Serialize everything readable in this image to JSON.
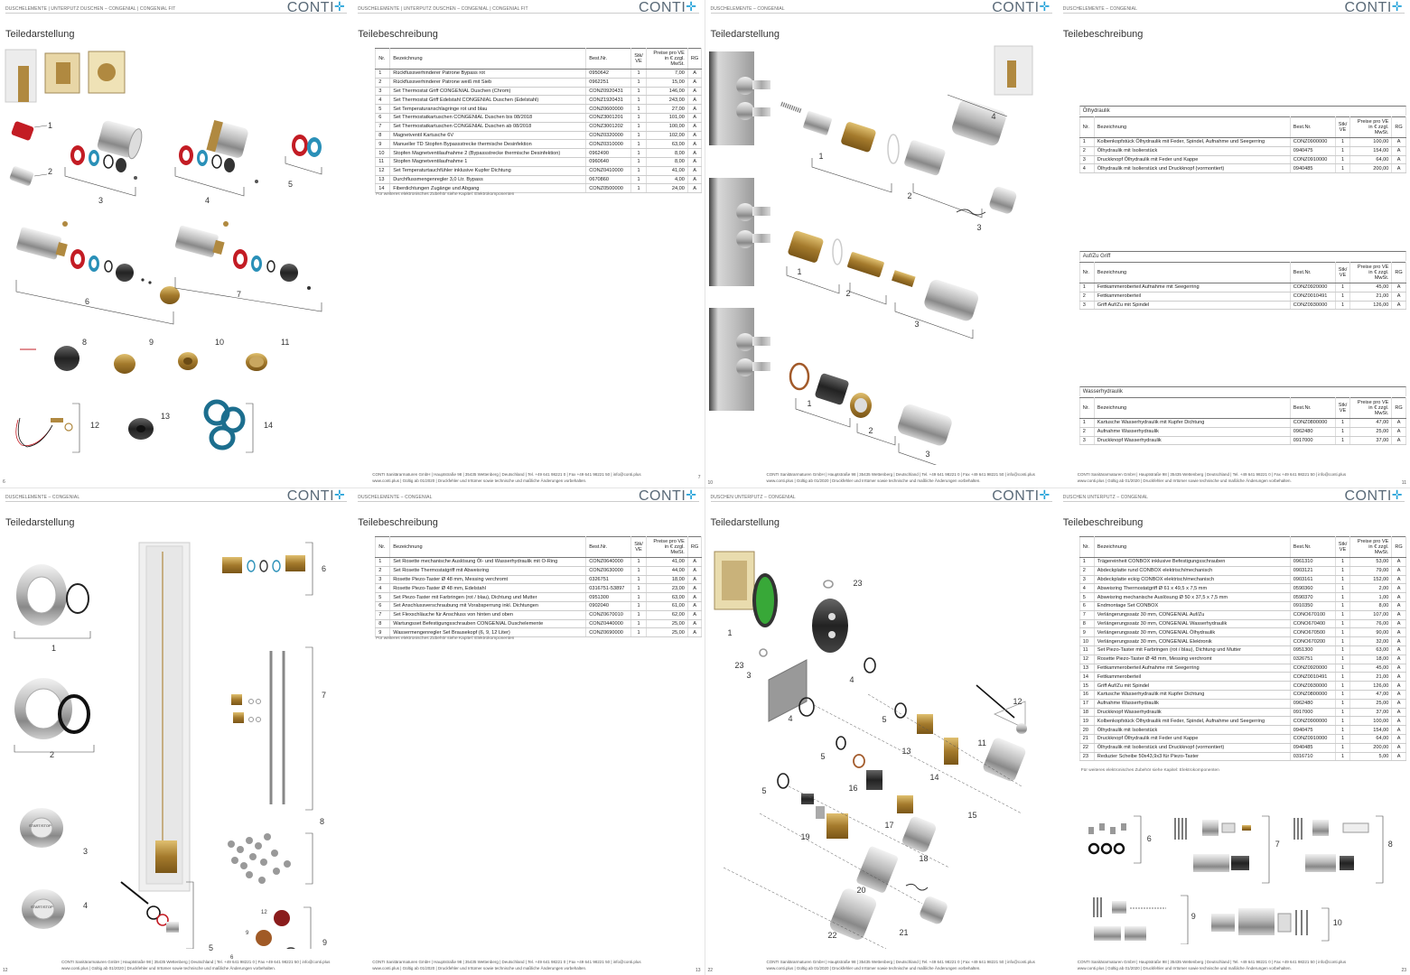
{
  "brand": {
    "logo_text": "CONTI",
    "accent": "#1fa0d8"
  },
  "footer": {
    "line1": "CONTI Sanitärarmaturen GmbH | Hauptstraße 98 | 35435 Wettenberg | Deutschland | Tel. +49 641 98221 0 | Fax +49 641 98221 50 | info@conti.plus",
    "line2": "www.conti.plus | Gültig ab 01/2020 | Druckfehler und Irrtümer sowie technische und maßliche Änderungen vorbehalten."
  },
  "table_headers": {
    "nr": "Nr.",
    "bez": "Bezeichnung",
    "best": "Best.Nr.",
    "stk": "Stk/ VE",
    "preis": "Preise pro VE in € zzgl. MwSt.",
    "preis2": "Preise pro VE in € zzgl. MwSt.",
    "rg": "RG"
  },
  "pages": [
    {
      "header": "DUSCHELEMENTE | UNTERPUTZ DUSCHEN – CONGENIAL | CONGENIAL FIT",
      "title": "Teiledarstellung",
      "num": "6",
      "labels": [
        "1",
        "2",
        "3",
        "4",
        "5",
        "6",
        "7",
        "8",
        "9",
        "10",
        "11",
        "12",
        "13",
        "14"
      ]
    },
    {
      "header": "DUSCHELEMENTE | UNTERPUTZ DUSCHEN – CONGENIAL | CONGENIAL FIT",
      "title": "Teilebeschreibung",
      "num": "7",
      "rows": [
        [
          "1",
          "Rückflussverhinderer Patrone Bypass rot",
          "0950642",
          "1",
          "7,00",
          "A"
        ],
        [
          "2",
          "Rückflussverhinderer Patrone weiß mit Sieb",
          "0962251",
          "1",
          "15,00",
          "A"
        ],
        [
          "3",
          "Set Thermostat Griff CONGENIAL Duschen (Chrom)",
          "CONZ0920431",
          "1",
          "146,00",
          "A"
        ],
        [
          "4",
          "Set Thermostat Griff Edelstahl CONGENIAL Duschen (Edelstahl)",
          "CONZ1920431",
          "1",
          "243,00",
          "A"
        ],
        [
          "5",
          "Set Temperaturanschlagringe rot und blau",
          "CONZ0600000",
          "1",
          "27,00",
          "A"
        ],
        [
          "6",
          "Set Thermostatkartuschen CONGENIAL Duschen bis 08/2018",
          "CONZ3001201",
          "1",
          "101,00",
          "A"
        ],
        [
          "7",
          "Set Thermostatkartuschen CONGENIAL Duschen ab 08/2018",
          "CONZ3001202",
          "1",
          "100,00",
          "A"
        ],
        [
          "8",
          "Magnetventil Kartusche 6V",
          "CONZ0320000",
          "1",
          "102,00",
          "A"
        ],
        [
          "9",
          "Manueller TD Stopfen Bypassstrecke thermische Desinfektion",
          "CONZ0310000",
          "1",
          "63,00",
          "A"
        ],
        [
          "10",
          "Stopfen Magnetventilaufnahme 2 (Bypassstrecke thermische Desinfektion)",
          "0962490",
          "1",
          "8,00",
          "A"
        ],
        [
          "11",
          "Stopfen Magnetventilaufnahme 1",
          "0960640",
          "1",
          "8,00",
          "A"
        ],
        [
          "12",
          "Set Temperaturtauchfühler inklusive Kupfer Dichtung",
          "CONZ0410000",
          "1",
          "41,00",
          "A"
        ],
        [
          "13",
          "Durchflussmengenregler 3,0 Ltr. Bypass",
          "0670860",
          "1",
          "4,00",
          "A"
        ],
        [
          "14",
          "Fiberdichtungen Zugänge und Abgang",
          "CONZ0500000",
          "1",
          "24,00",
          "A"
        ]
      ],
      "note": "Für weiteres elektronisches Zubehör siehe Kapitel: Elektrokomponenten"
    },
    {
      "header": "DUSCHELEMENTE – CONGENIAL",
      "title": "Teiledarstellung",
      "num": "10",
      "labels": [
        "4",
        "1",
        "2",
        "3",
        "1",
        "2",
        "3",
        "1",
        "2",
        "3"
      ]
    },
    {
      "header": "DUSCHELEMENTE – CONGENIAL",
      "title": "Teilebeschreibung",
      "num": "11",
      "sections": [
        {
          "name": "Ölhydraulik",
          "rows": [
            [
              "1",
              "Kolbenkopfstück Ölhydraulik mit Feder, Spindel, Aufnahme und Seegerring",
              "CONZ0900000",
              "1",
              "100,00",
              "A"
            ],
            [
              "2",
              "Ölhydraulik mit Isolierstück",
              "0940475",
              "1",
              "154,00",
              "A"
            ],
            [
              "3",
              "Druckknopf Ölhydraulik mit Feder und Kappe",
              "CONZ0910000",
              "1",
              "64,00",
              "A"
            ],
            [
              "4",
              "Ölhydraulik mit Isolierstück und Druckknopf (vormontiert)",
              "0940485",
              "1",
              "200,00",
              "A"
            ]
          ]
        },
        {
          "name": "Auf/Zu Griff",
          "rows": [
            [
              "1",
              "Fettkammeroberteil Aufnahme mit Seegerring",
              "CONZ0920000",
              "1",
              "45,00",
              "A"
            ],
            [
              "2",
              "Fettkammeroberteil",
              "CONZ0010491",
              "1",
              "21,00",
              "A"
            ],
            [
              "3",
              "Griff Auf/Zu mit Spindel",
              "CONZ0930000",
              "1",
              "126,00",
              "A"
            ]
          ]
        },
        {
          "name": "Wasserhydraulik",
          "rows": [
            [
              "1",
              "Kartusche Wasserhydraulik mit Kupfer Dichtung",
              "CONZ0800000",
              "1",
              "47,00",
              "A"
            ],
            [
              "2",
              "Aufnahme Wasserhydraulik",
              "0962480",
              "1",
              "25,00",
              "A"
            ],
            [
              "3",
              "Druckknopf Wasserhydraulik",
              "0917000",
              "1",
              "37,00",
              "A"
            ]
          ]
        }
      ]
    },
    {
      "header": "DUSCHELEMENTE – CONGENIAL",
      "title": "Teiledarstellung",
      "num": "12",
      "labels": [
        "1",
        "2",
        "3",
        "4",
        "5",
        "6",
        "7",
        "8",
        "9",
        "12",
        "9",
        "6"
      ],
      "startstop": "START/STOP"
    },
    {
      "header": "DUSCHELEMENTE – CONGENIAL",
      "title": "Teilebeschreibung",
      "num": "13",
      "rows": [
        [
          "1",
          "Set Rosette mechanische Auslösung Öl- und Wasserhydraulik mit O-Ring",
          "CONZ0640000",
          "1",
          "41,00",
          "A"
        ],
        [
          "2",
          "Set Rosette Thermostatgriff mit Abweisring",
          "CONZ0630000",
          "1",
          "44,00",
          "A"
        ],
        [
          "3",
          "Rosette Piezo-Taster Ø 48 mm, Messing verchromt",
          "0326751",
          "1",
          "18,00",
          "A"
        ],
        [
          "4",
          "Rosette Piezo-Taster Ø 48 mm, Edelstahl",
          "0316751-53897",
          "1",
          "23,00",
          "A"
        ],
        [
          "5",
          "Set Piezo-Taster mit Farbringen (rot / blau), Dichtung und Mutter",
          "0951300",
          "1",
          "63,00",
          "A"
        ],
        [
          "6",
          "Set Anschlussverschraubung mit Vorabsperrung inkl. Dichtungen",
          "0902040",
          "1",
          "61,00",
          "A"
        ],
        [
          "7",
          "Set Flexschläuche für Anschluss von hinten und oben",
          "CONZ0670010",
          "1",
          "62,00",
          "A"
        ],
        [
          "8",
          "Wartungsset Befestigungsschrauben CONGENIAL Duschelemente",
          "CONZ0440000",
          "1",
          "25,00",
          "A"
        ],
        [
          "9",
          "Wassermengenregler Set Brausekopf (6, 9, 12 Liter)",
          "CONZ0690000",
          "1",
          "25,00",
          "A"
        ]
      ],
      "note": "Für weiteres elektronisches Zubehör siehe Kapitel: Elektrokomponenten"
    },
    {
      "header": "DUSCHEN UNTERPUTZ – CONGENIAL",
      "title": "Teiledarstellung",
      "num": "22",
      "labels": [
        "23",
        "1",
        "2",
        "23",
        "3",
        "4",
        "4",
        "5",
        "5",
        "5",
        "12",
        "11",
        "13",
        "14",
        "16",
        "15",
        "17",
        "18",
        "19",
        "20",
        "21",
        "22"
      ]
    },
    {
      "header": "DUSCHEN UNTERPUTZ – CONGENIAL",
      "title": "Teilebeschreibung",
      "num": "23",
      "rows": [
        [
          "1",
          "Trägereinheit CONBOX inklusive Befestigungsschrauben",
          "0961310",
          "1",
          "53,00",
          "A"
        ],
        [
          "2",
          "Abdeckplatte rund CONBOX elektrisch/mechanisch",
          "0903121",
          "1",
          "79,00",
          "A"
        ],
        [
          "3",
          "Abdeckplatte eckig CONBOX elektrisch/mechanisch",
          "0903161",
          "1",
          "152,00",
          "A"
        ],
        [
          "4",
          "Abweisring Thermostatgriff Ø 61 x 49,5 x 7,5 mm",
          "0590360",
          "1",
          "2,00",
          "A"
        ],
        [
          "5",
          "Abweisring mechanische Auslösung Ø 50 x 37,5 x 7,5 mm",
          "0590370",
          "1",
          "1,00",
          "A"
        ],
        [
          "6",
          "Endmontage Set CONBOX",
          "0910350",
          "1",
          "8,00",
          "A"
        ],
        [
          "7",
          "Verlängerungssatz 30 mm, CONGENIAL Auf/Zu",
          "CONO670100",
          "1",
          "107,00",
          "A"
        ],
        [
          "8",
          "Verlängerungssatz 30 mm, CONGENIAL Wasserhydraulik",
          "CONO670400",
          "1",
          "76,00",
          "A"
        ],
        [
          "9",
          "Verlängerungssatz 30 mm, CONGENIAL Ölhydraulik",
          "CONO670500",
          "1",
          "90,00",
          "A"
        ],
        [
          "10",
          "Verlängerungssatz 30 mm, CONGENIAL Elektronik",
          "CONO670200",
          "1",
          "32,00",
          "A"
        ],
        [
          "11",
          "Set Piezo-Taster mit Farbringen (rot / blau), Dichtung und Mutter",
          "0951300",
          "1",
          "63,00",
          "A"
        ],
        [
          "12",
          "Rosette Piezo-Taster Ø 48 mm, Messing verchromt",
          "0326751",
          "1",
          "18,00",
          "A"
        ],
        [
          "13",
          "Fettkammeroberteil Aufnahme mit Seegerring",
          "CONZ0920000",
          "1",
          "45,00",
          "A"
        ],
        [
          "14",
          "Fettkammeroberteil",
          "CONZ0010491",
          "1",
          "21,00",
          "A"
        ],
        [
          "15",
          "Griff Auf/Zu mit Spindel",
          "CONZ0930000",
          "1",
          "126,00",
          "A"
        ],
        [
          "16",
          "Kartusche Wasserhydraulik mit Kupfer Dichtung",
          "CONZ0800000",
          "1",
          "47,00",
          "A"
        ],
        [
          "17",
          "Aufnahme Wasserhydraulik",
          "0962480",
          "1",
          "25,00",
          "A"
        ],
        [
          "18",
          "Druckknopf Wasserhydraulik",
          "0917000",
          "1",
          "37,00",
          "A"
        ],
        [
          "19",
          "Kolbenkopfstück Ölhydraulik mit Feder, Spindel, Aufnahme und Seegerring",
          "CONZ0900000",
          "1",
          "100,00",
          "A"
        ],
        [
          "20",
          "Ölhydraulik mit Isolierstück",
          "0940475",
          "1",
          "154,00",
          "A"
        ],
        [
          "21",
          "Druckknopf Ölhydraulik mit Feder und Kappe",
          "CONZ0910000",
          "1",
          "64,00",
          "A"
        ],
        [
          "22",
          "Ölhydraulik mit Isolierstück und Druckknopf (vormontiert)",
          "0940485",
          "1",
          "200,00",
          "A"
        ],
        [
          "23",
          "Reduzier Scheibe 50x43,9x3 für Piezo-Taster",
          "0316710",
          "1",
          "5,00",
          "A"
        ]
      ],
      "note": "Für weiteres elektronisches Zubehör siehe Kapitel: Elektrokomponenten",
      "labels": [
        "6",
        "7",
        "8",
        "9",
        "10"
      ]
    }
  ]
}
